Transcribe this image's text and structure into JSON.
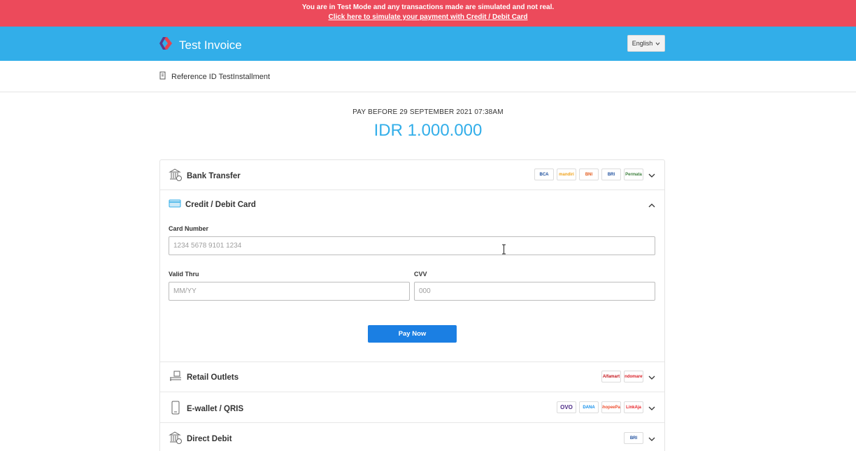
{
  "banner": {
    "message": "You are in Test Mode and any transactions made are simulated and not real.",
    "link": "Click here to simulate your payment with Credit / Debit Card"
  },
  "header": {
    "title": "Test Invoice",
    "language": "English"
  },
  "reference": {
    "text": "Reference ID TestInstallment"
  },
  "invoice": {
    "due": "PAY BEFORE 29 SEPTEMBER 2021 07:38AM",
    "amount": "IDR 1.000.000"
  },
  "methods": {
    "bank_transfer": {
      "label": "Bank Transfer",
      "logos": [
        "BCA",
        "mandiri",
        "BNI",
        "BRI",
        "Permata"
      ]
    },
    "card": {
      "label": "Credit / Debit Card",
      "card_number_label": "Card Number",
      "card_number_placeholder": "1234 5678 9101 1234",
      "valid_thru_label": "Valid Thru",
      "valid_thru_placeholder": "MM/YY",
      "cvv_label": "CVV",
      "cvv_placeholder": "000",
      "pay_button": "Pay Now"
    },
    "retail": {
      "label": "Retail Outlets",
      "logos": [
        "Alfamart",
        "Indomaret"
      ]
    },
    "ewallet": {
      "label": "E-wallet / QRIS",
      "logos": [
        "OVO",
        "DANA",
        "ShopeePay",
        "LinkAja"
      ]
    },
    "direct_debit": {
      "label": "Direct Debit",
      "logos": [
        "BRI"
      ]
    }
  },
  "colors": {
    "banner": "#ec4a5b",
    "header": "#32aee9",
    "amount": "#32aee9",
    "button": "#1b7fe3"
  }
}
